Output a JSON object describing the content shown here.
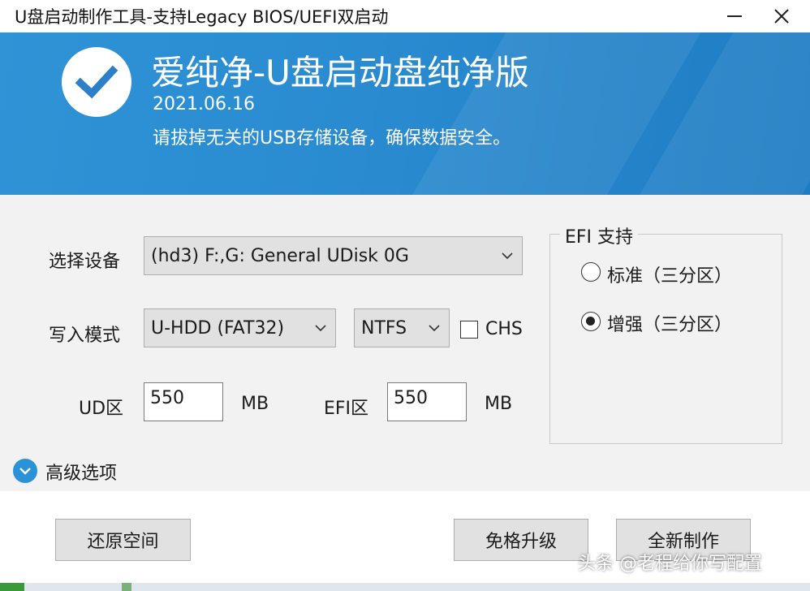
{
  "window": {
    "title": "U盘启动制作工具-支持Legacy BIOS/UEFI双启动"
  },
  "banner": {
    "title": "爱纯净-U盘启动盘纯净版",
    "date": "2021.06.16",
    "note": "请拔掉无关的USB存储设备，确保数据安全。",
    "icon": "check-icon"
  },
  "form": {
    "device_label": "选择设备",
    "device_value": "(hd3) F:,G: General UDisk 0G",
    "mode_label": "写入模式",
    "mode_value": "U-HDD (FAT32)",
    "fs_value": "NTFS",
    "chs_label": "CHS",
    "chs_checked": false,
    "ud_label": "UD区",
    "ud_value": "550",
    "ud_unit": "MB",
    "efi_label": "EFI区",
    "efi_value": "550",
    "efi_unit": "MB"
  },
  "efi_support": {
    "legend": "EFI 支持",
    "options": [
      {
        "label": "标准（三分区）",
        "selected": false
      },
      {
        "label": "增强（三分区）",
        "selected": true
      }
    ]
  },
  "advanced": {
    "label": "高级选项"
  },
  "buttons": {
    "restore": "还原空间",
    "upgrade": "免格升级",
    "create": "全新制作"
  },
  "watermark": "头条 @老程给你写配置",
  "colors": {
    "banner_blue": "#2a8bd0",
    "accent_blue": "#2c92d8",
    "form_bg": "#f2f2f2"
  }
}
